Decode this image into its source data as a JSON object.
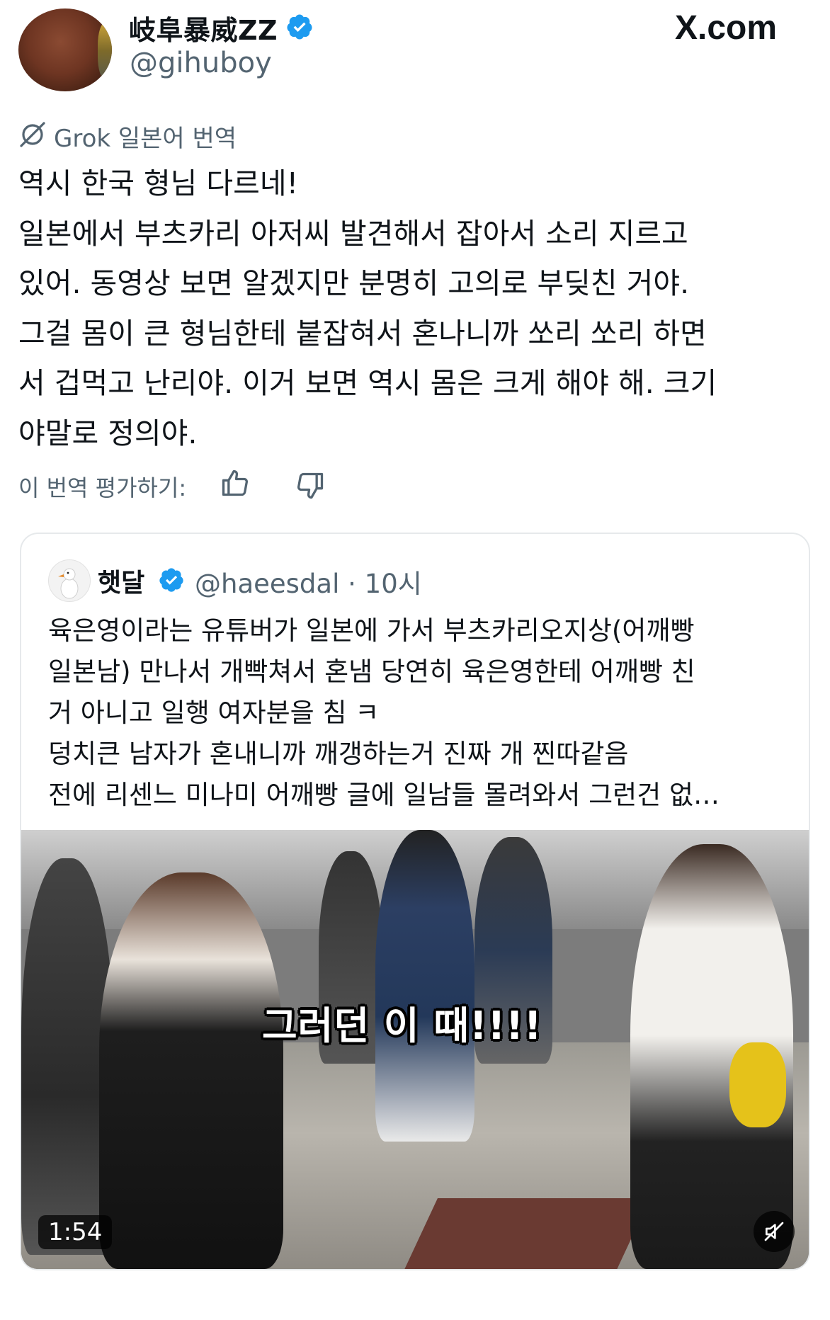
{
  "author": {
    "display_name": "岐阜暴威ZZ",
    "handle": "@gihuboy"
  },
  "brand": "X.com",
  "translation": {
    "label": "Grok 일본어 번역",
    "lines": [
      "역시 한국 형님 다르네!",
      "일본에서 부츠카리 아저씨 발견해서 잡아서 소리 지르고",
      "있어. 동영상 보면 알겠지만 분명히 고의로 부딪친 거야.",
      "그걸 몸이 큰 형님한테 붙잡혀서 혼나니까 쏘리 쏘리 하면",
      "서 겁먹고 난리야. 이거 보면 역시 몸은 크게 해야 해. 크기",
      "야말로 정의야."
    ],
    "rate_label": "이 번역 평가하기:"
  },
  "quote": {
    "display_name": "햇달",
    "handle_time": "@haeesdal · 10시",
    "lines": [
      "육은영이라는 유튜버가 일본에 가서  부츠카리오지상(어깨빵",
      "일본남) 만나서 개빡쳐서 혼냄 당연히 육은영한테 어깨빵 친",
      "거 아니고 일행 여자분을 침 ㅋ",
      "덩치큰 남자가 혼내니까 깨갱하는거 진짜 개 찐따같음",
      "전에 리센느 미나미 어깨빵 글에 일남들 몰려와서 그런건 없…"
    ],
    "video": {
      "subtitle": "그러던 이 때!!!!",
      "duration": "1:54"
    }
  },
  "colors": {
    "verified": "#1d9bf0",
    "secondary_text": "#536471"
  }
}
